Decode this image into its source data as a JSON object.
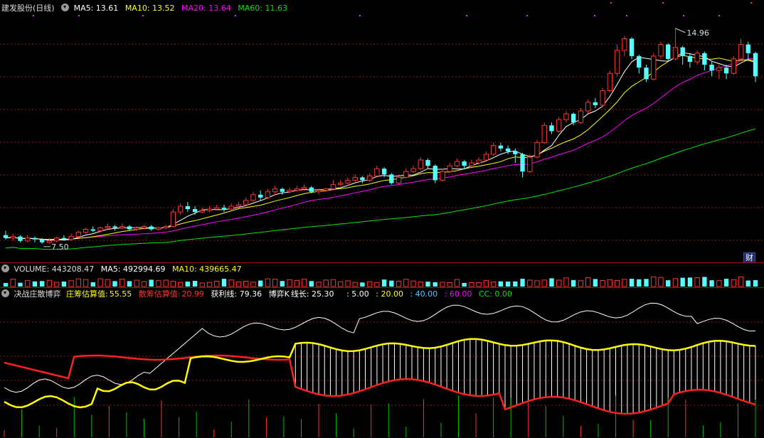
{
  "main": {
    "title": "建发股份(日线)",
    "ma5": "MA5: 13.61",
    "ma10": "MA10: 13.52",
    "ma20": "MA20: 13.64",
    "ma60": "MA60: 11.63",
    "high_label": "14.96",
    "low_label": "7.50",
    "corner_button": "财"
  },
  "volume": {
    "label": "VOLUME: 443208.47",
    "ma5": "MA5: 492994.69",
    "ma10": "MA10: 439665.47"
  },
  "indicator": {
    "name": "决战庄散博弈",
    "zhuang_label": "庄筹估算值:",
    "zhuang_value": "55.55",
    "san_label": "散筹估算值:",
    "san_value": "20.99",
    "profit": "获利线: 79.36",
    "game_k": "博弈K",
    "line_len": "线长: 25.30",
    "l5": ": 5.00",
    "l20": ": 20.00",
    "l40": ": 40.00",
    "l60": ": 60.00",
    "cc": "CC: 0.00"
  },
  "colors": {
    "up": "#ff3232",
    "down": "#54ffff",
    "ma5": "#ffffff",
    "ma10": "#ffff00",
    "ma20": "#ff00ff",
    "ma60": "#00e600",
    "grid": "#8b1a1a"
  },
  "chart_data": {
    "type": "candlestick",
    "price_range": [
      7.5,
      14.96
    ],
    "candles": [
      [
        7.8,
        7.7,
        7.95,
        7.65
      ],
      [
        7.7,
        7.75,
        7.85,
        7.6
      ],
      [
        7.75,
        7.6,
        7.8,
        7.55
      ],
      [
        7.6,
        7.7,
        7.8,
        7.55
      ],
      [
        7.7,
        7.65,
        7.75,
        7.55
      ],
      [
        7.65,
        7.55,
        7.7,
        7.5
      ],
      [
        7.55,
        7.6,
        7.7,
        7.5
      ],
      [
        7.6,
        7.7,
        7.75,
        7.55
      ],
      [
        7.7,
        7.65,
        7.8,
        7.6
      ],
      [
        7.65,
        7.75,
        7.85,
        7.6
      ],
      [
        7.75,
        7.9,
        7.95,
        7.7
      ],
      [
        7.9,
        8.0,
        8.05,
        7.85
      ],
      [
        8.0,
        7.95,
        8.1,
        7.9
      ],
      [
        7.95,
        8.05,
        8.1,
        7.9
      ],
      [
        8.05,
        8.1,
        8.2,
        8.0
      ],
      [
        8.1,
        8.05,
        8.15,
        7.95
      ],
      [
        8.05,
        8.1,
        8.2,
        8.0
      ],
      [
        8.1,
        8.0,
        8.15,
        7.95
      ],
      [
        8.0,
        8.05,
        8.1,
        7.95
      ],
      [
        8.05,
        8.1,
        8.15,
        8.0
      ],
      [
        8.1,
        8.0,
        8.15,
        7.95
      ],
      [
        8.0,
        8.05,
        8.1,
        7.95
      ],
      [
        8.05,
        8.1,
        8.15,
        8.0
      ],
      [
        8.1,
        8.6,
        8.7,
        8.05
      ],
      [
        8.6,
        8.8,
        8.9,
        8.5
      ],
      [
        8.8,
        8.7,
        8.95,
        8.6
      ],
      [
        8.7,
        8.6,
        8.8,
        8.5
      ],
      [
        8.6,
        8.65,
        8.75,
        8.55
      ],
      [
        8.65,
        8.7,
        8.8,
        8.6
      ],
      [
        8.7,
        8.75,
        8.85,
        8.65
      ],
      [
        8.75,
        8.7,
        8.85,
        8.6
      ],
      [
        8.7,
        8.8,
        8.9,
        8.65
      ],
      [
        8.8,
        8.85,
        8.95,
        8.75
      ],
      [
        8.85,
        9.0,
        9.1,
        8.8
      ],
      [
        9.0,
        9.2,
        9.3,
        8.95
      ],
      [
        9.2,
        9.1,
        9.35,
        9.0
      ],
      [
        9.1,
        9.3,
        9.4,
        9.05
      ],
      [
        9.3,
        9.4,
        9.5,
        9.2
      ],
      [
        9.4,
        9.3,
        9.45,
        9.2
      ],
      [
        9.3,
        9.35,
        9.45,
        9.25
      ],
      [
        9.35,
        9.4,
        9.5,
        9.3
      ],
      [
        9.4,
        9.45,
        9.55,
        9.35
      ],
      [
        9.45,
        9.3,
        9.5,
        9.25
      ],
      [
        9.3,
        9.35,
        9.4,
        9.2
      ],
      [
        9.35,
        9.4,
        9.45,
        9.3
      ],
      [
        9.4,
        9.55,
        9.7,
        9.35
      ],
      [
        9.55,
        9.6,
        9.7,
        9.5
      ],
      [
        9.6,
        9.7,
        9.8,
        9.5
      ],
      [
        9.7,
        9.8,
        9.9,
        9.65
      ],
      [
        9.8,
        9.7,
        9.85,
        9.6
      ],
      [
        9.7,
        9.85,
        9.95,
        9.65
      ],
      [
        9.85,
        10.1,
        10.2,
        9.8
      ],
      [
        10.1,
        9.9,
        10.15,
        9.8
      ],
      [
        9.9,
        9.6,
        9.95,
        9.55
      ],
      [
        9.6,
        9.8,
        9.9,
        9.55
      ],
      [
        9.8,
        10.0,
        10.1,
        9.75
      ],
      [
        10.0,
        10.1,
        10.2,
        9.95
      ],
      [
        10.1,
        10.4,
        10.5,
        10.05
      ],
      [
        10.4,
        10.2,
        10.45,
        10.1
      ],
      [
        10.2,
        9.7,
        10.25,
        9.6
      ],
      [
        9.7,
        10.0,
        10.1,
        9.65
      ],
      [
        10.0,
        10.2,
        10.3,
        9.95
      ],
      [
        10.2,
        10.35,
        10.45,
        10.15
      ],
      [
        10.35,
        10.2,
        10.4,
        10.1
      ],
      [
        10.2,
        10.3,
        10.4,
        10.15
      ],
      [
        10.3,
        10.4,
        10.5,
        10.25
      ],
      [
        10.4,
        10.6,
        10.7,
        10.35
      ],
      [
        10.6,
        10.9,
        11.0,
        10.55
      ],
      [
        10.9,
        10.8,
        11.0,
        10.7
      ],
      [
        10.8,
        10.7,
        10.9,
        10.6
      ],
      [
        10.7,
        10.6,
        10.8,
        10.3
      ],
      [
        10.6,
        10.0,
        10.65,
        9.8
      ],
      [
        10.0,
        10.5,
        10.6,
        9.95
      ],
      [
        10.5,
        11.0,
        11.1,
        10.45
      ],
      [
        11.0,
        11.6,
        11.7,
        10.95
      ],
      [
        11.6,
        11.4,
        11.7,
        11.3
      ],
      [
        11.4,
        11.8,
        11.9,
        11.35
      ],
      [
        11.8,
        12.0,
        12.1,
        11.7
      ],
      [
        12.0,
        11.7,
        12.05,
        11.6
      ],
      [
        11.7,
        12.1,
        12.2,
        11.65
      ],
      [
        12.1,
        12.4,
        12.5,
        12.0
      ],
      [
        12.4,
        12.3,
        12.55,
        12.2
      ],
      [
        12.3,
        12.8,
        12.9,
        12.25
      ],
      [
        12.8,
        13.4,
        13.5,
        12.75
      ],
      [
        13.4,
        14.2,
        14.4,
        13.3
      ],
      [
        14.2,
        14.6,
        14.7,
        14.0
      ],
      [
        14.6,
        14.0,
        14.65,
        13.9
      ],
      [
        14.0,
        13.6,
        14.05,
        13.4
      ],
      [
        13.6,
        13.2,
        13.7,
        13.1
      ],
      [
        13.2,
        14.0,
        14.1,
        13.15
      ],
      [
        14.0,
        14.4,
        14.5,
        13.9
      ],
      [
        14.4,
        13.9,
        14.45,
        13.8
      ],
      [
        13.9,
        14.3,
        14.96,
        13.85
      ],
      [
        14.3,
        14.0,
        14.35,
        13.7
      ],
      [
        14.0,
        13.8,
        14.1,
        13.6
      ],
      [
        13.8,
        14.1,
        14.2,
        13.7
      ],
      [
        14.1,
        13.7,
        14.15,
        13.5
      ],
      [
        13.7,
        13.5,
        13.8,
        13.3
      ],
      [
        13.5,
        13.6,
        13.7,
        13.2
      ],
      [
        13.6,
        13.4,
        13.7,
        13.2
      ],
      [
        13.4,
        13.9,
        14.0,
        13.35
      ],
      [
        13.9,
        14.4,
        14.6,
        13.85
      ],
      [
        14.4,
        14.1,
        14.5,
        13.9
      ],
      [
        14.1,
        13.3,
        14.15,
        13.1
      ]
    ]
  }
}
